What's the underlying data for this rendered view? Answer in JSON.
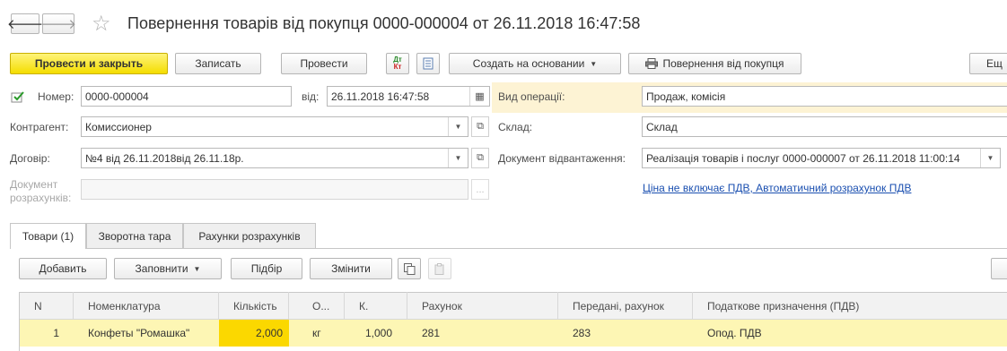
{
  "window": {
    "title": "Повернення товарів від покупця 0000-000004 от 26.11.2018 16:47:58",
    "back_glyph": "🡐",
    "forward_glyph": "🡒",
    "star_glyph": "☆"
  },
  "toolbar": {
    "post_close": "Провести и закрыть",
    "save": "Записать",
    "post": "Провести",
    "dtkt_top": "Дт",
    "dtkt_bottom": "Кт",
    "create_based": "Создать на основании",
    "print_return": "Повернення від покупця",
    "more": "Ещ"
  },
  "header": {
    "number_label": "Номер:",
    "number_value": "0000-000004",
    "date_label": "від:",
    "date_value": "26.11.2018 16:47:58",
    "operation_label": "Вид операції:",
    "operation_value": "Продаж, комісія",
    "counterparty_label": "Контрагент:",
    "counterparty_value": "Комиссионер",
    "warehouse_label": "Склад:",
    "warehouse_value": "Склад",
    "contract_label": "Договір:",
    "contract_value": "№4 від 26.11.2018від 26.11.18р.",
    "shipment_label": "Документ відвантаження:",
    "shipment_value": "Реалізація товарів і послуг 0000-000007 от 26.11.2018 11:00:14",
    "settlement_label_line1": "Документ",
    "settlement_label_line2": "розрахунків:",
    "vat_link": "Ціна не включає ПДВ, Автоматичний розрахунок ПДВ"
  },
  "tabs": [
    {
      "label": "Товари (1)"
    },
    {
      "label": "Зворотна тара"
    },
    {
      "label": "Рахунки розрахунків"
    }
  ],
  "table_toolbar": {
    "add": "Добавить",
    "fill": "Заповнити",
    "select": "Підбір",
    "change": "Змінити"
  },
  "table": {
    "columns": [
      "N",
      "Номенклатура",
      "Кількість",
      "О...",
      "К.",
      "Рахунок",
      "Передані, рахунок",
      "Податкове призначення (ПДВ)"
    ],
    "rows": [
      {
        "n": "1",
        "item": "Конфеты \"Ромашка\"",
        "qty": "2,000",
        "unit": "кг",
        "coef": "1,000",
        "account": "281",
        "transferred_account": "283",
        "vat_purpose": "Опод. ПДВ"
      }
    ]
  },
  "colors": {
    "accent_yellow": "#f4dd00",
    "row_highlight": "#fdf6b4",
    "cell_selected": "#fbd800",
    "link_blue": "#1a4fb0"
  }
}
